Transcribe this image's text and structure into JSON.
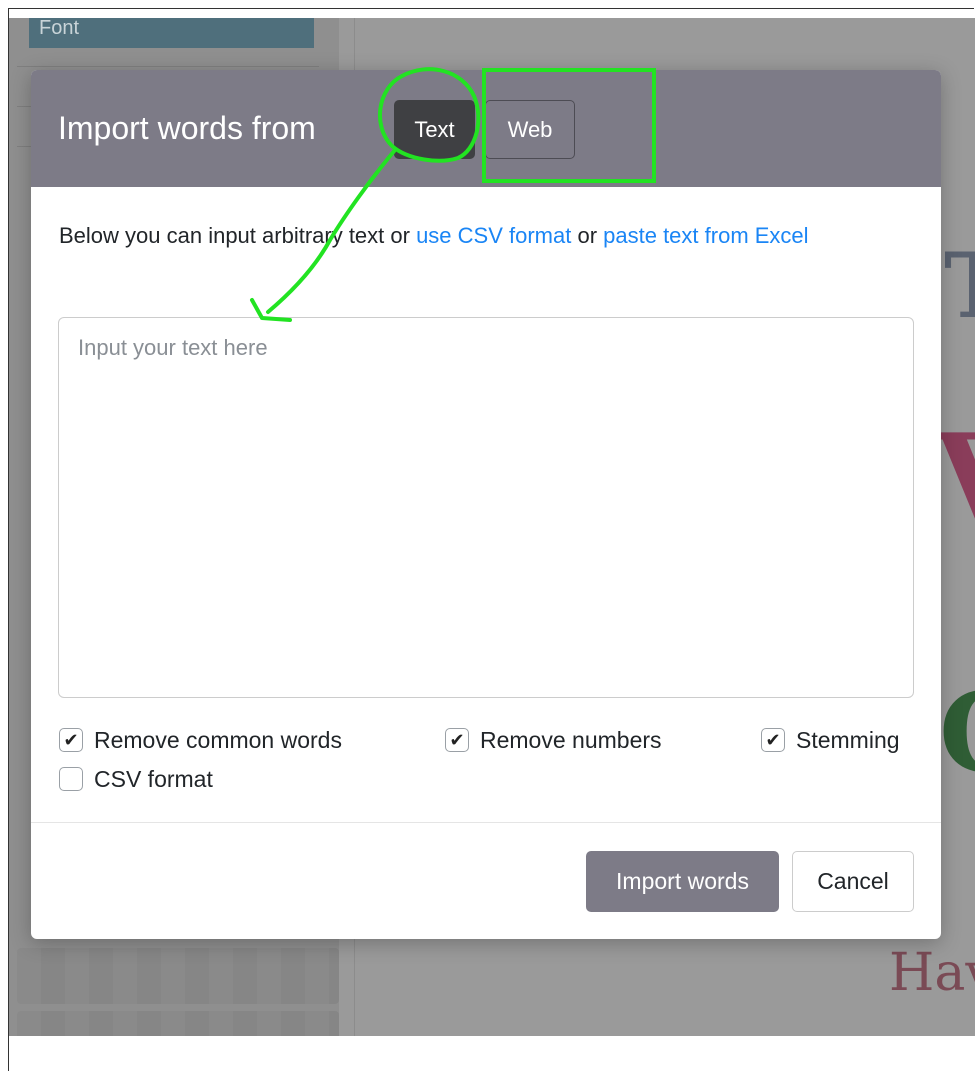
{
  "background": {
    "sidebar_tab_label": "Font"
  },
  "modal": {
    "title": "Import words from",
    "tabs": [
      {
        "label": "Text",
        "active": true
      },
      {
        "label": "Web",
        "active": false
      }
    ],
    "description": {
      "prefix": "Below you can input arbitrary text or ",
      "link_csv": "use CSV format",
      "middle": " or ",
      "link_excel": "paste text from Excel"
    },
    "textarea": {
      "placeholder": "Input your text here",
      "value": ""
    },
    "options": [
      {
        "label": "Remove common words",
        "checked": true
      },
      {
        "label": "Remove numbers",
        "checked": true
      },
      {
        "label": "Stemming",
        "checked": true
      },
      {
        "label": "CSV format",
        "checked": false
      }
    ],
    "footer": {
      "import_label": "Import words",
      "cancel_label": "Cancel"
    }
  },
  "colors": {
    "header": "#7d7b87",
    "active_tab": "#3f4043",
    "link": "#1a85f5",
    "annotation": "#22e322"
  }
}
